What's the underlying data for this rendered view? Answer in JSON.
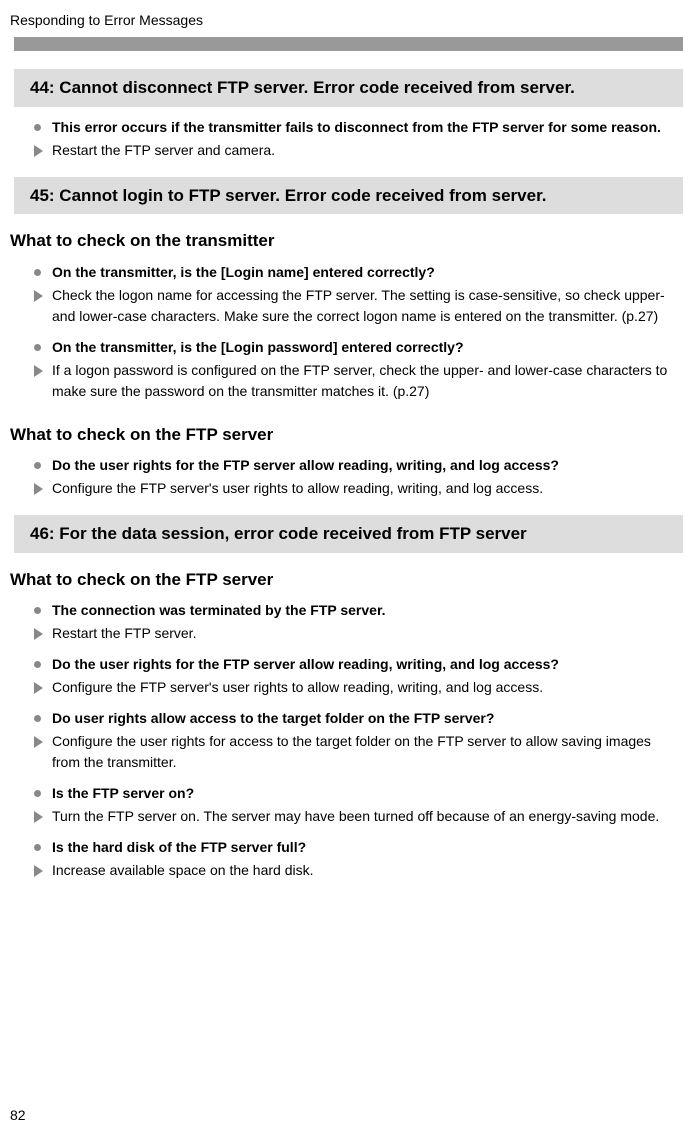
{
  "header": "Responding to Error Messages",
  "pageNumber": "82",
  "sections": [
    {
      "errorTitle": "44:  Cannot disconnect FTP server. Error code received from server.",
      "blocks": [
        {
          "items": [
            {
              "type": "disc",
              "bold": true,
              "text": "This error occurs if the transmitter fails to disconnect from the FTP server for some reason."
            },
            {
              "type": "arrow",
              "bold": false,
              "text": "Restart the FTP server and camera."
            }
          ]
        }
      ]
    },
    {
      "errorTitle": "45:  Cannot login to FTP server. Error code received from server.",
      "blocks": [
        {
          "heading": "What to check on the transmitter",
          "items": [
            {
              "type": "disc",
              "bold": true,
              "text": "On the transmitter, is the [Login name] entered correctly?"
            },
            {
              "type": "arrow",
              "bold": false,
              "text": "Check the logon name for accessing the FTP server. The setting is case-sensitive, so check upper- and lower-case characters. Make sure the correct logon name is entered on the transmitter. (p.27)"
            },
            {
              "type": "disc",
              "bold": true,
              "text": "On the transmitter, is the [Login password] entered correctly?"
            },
            {
              "type": "arrow",
              "bold": false,
              "text": "If a logon password is configured on the FTP server, check the upper- and lower-case characters to make sure the password on the transmitter matches it. (p.27)"
            }
          ]
        },
        {
          "heading": "What to check on the FTP server",
          "items": [
            {
              "type": "disc",
              "bold": true,
              "text": "Do the user rights for the FTP server allow reading, writing, and log access?"
            },
            {
              "type": "arrow",
              "bold": false,
              "text": "Configure the FTP server's user rights to allow reading, writing, and log access."
            }
          ]
        }
      ]
    },
    {
      "errorTitle": "46:  For the data session, error code received from FTP server",
      "blocks": [
        {
          "heading": "What to check on the FTP server",
          "items": [
            {
              "type": "disc",
              "bold": true,
              "text": "The connection was terminated by the FTP server."
            },
            {
              "type": "arrow",
              "bold": false,
              "text": "Restart the FTP server."
            },
            {
              "type": "disc",
              "bold": true,
              "text": "Do the user rights for the FTP server allow reading, writing, and log access?"
            },
            {
              "type": "arrow",
              "bold": false,
              "text": "Configure the FTP server's user rights to allow reading, writing, and log access."
            },
            {
              "type": "disc",
              "bold": true,
              "text": "Do user rights allow access to the target folder on the FTP server?"
            },
            {
              "type": "arrow",
              "bold": false,
              "text": "Configure the user rights for access to the target folder on the FTP server to allow saving images from the transmitter."
            },
            {
              "type": "disc",
              "bold": true,
              "text": "Is the FTP server on?"
            },
            {
              "type": "arrow",
              "bold": false,
              "text": "Turn the FTP server on. The server may have been turned off because of an energy-saving mode."
            },
            {
              "type": "disc",
              "bold": true,
              "text": "Is the hard disk of the FTP server full?"
            },
            {
              "type": "arrow",
              "bold": false,
              "text": "Increase available space on the hard disk."
            }
          ]
        }
      ]
    }
  ]
}
